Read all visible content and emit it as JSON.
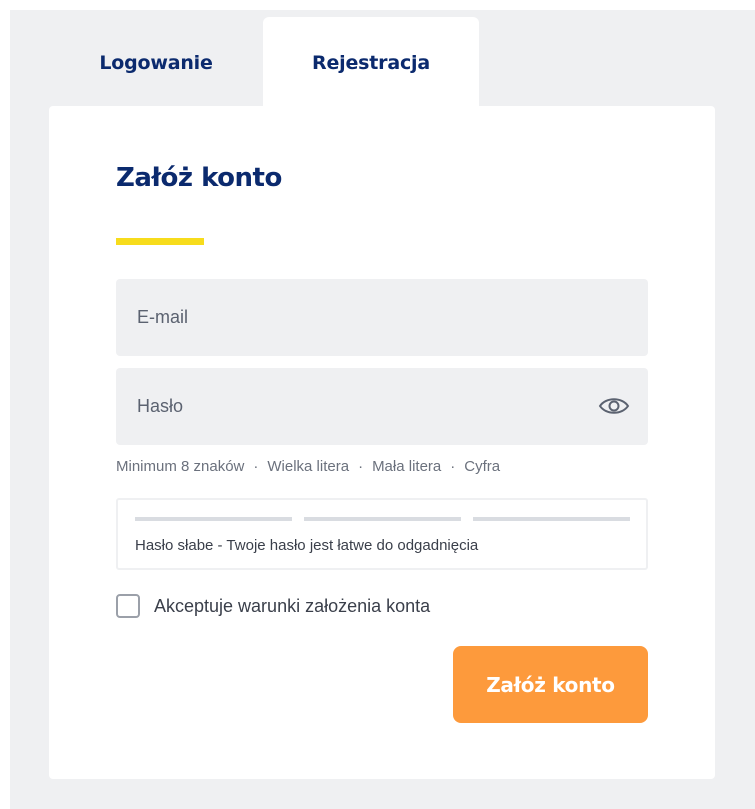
{
  "tabs": {
    "login_label": "Logowanie",
    "register_label": "Rejestracja",
    "active": "register"
  },
  "form": {
    "title": "Załóż konto",
    "email": {
      "placeholder": "E-mail",
      "value": ""
    },
    "password": {
      "placeholder": "Hasło",
      "value": "",
      "toggle_icon": "eye-icon"
    },
    "password_rules": [
      "Minimum 8 znaków",
      "Wielka litera",
      "Mała litera",
      "Cyfra"
    ],
    "rule_separator": "·",
    "strength": {
      "segments_filled": 0,
      "segments_total": 3,
      "message": "Hasło słabe - Twoje hasło jest łatwe do odgadnięcia"
    },
    "terms": {
      "checked": false,
      "label": "Akceptuje warunki założenia konta"
    },
    "submit_label": "Załóż konto"
  },
  "colors": {
    "brand_navy": "#0b2a6e",
    "accent_yellow": "#f7dc1c",
    "submit_orange": "#fd9a3c",
    "background_gray": "#eff0f2"
  }
}
